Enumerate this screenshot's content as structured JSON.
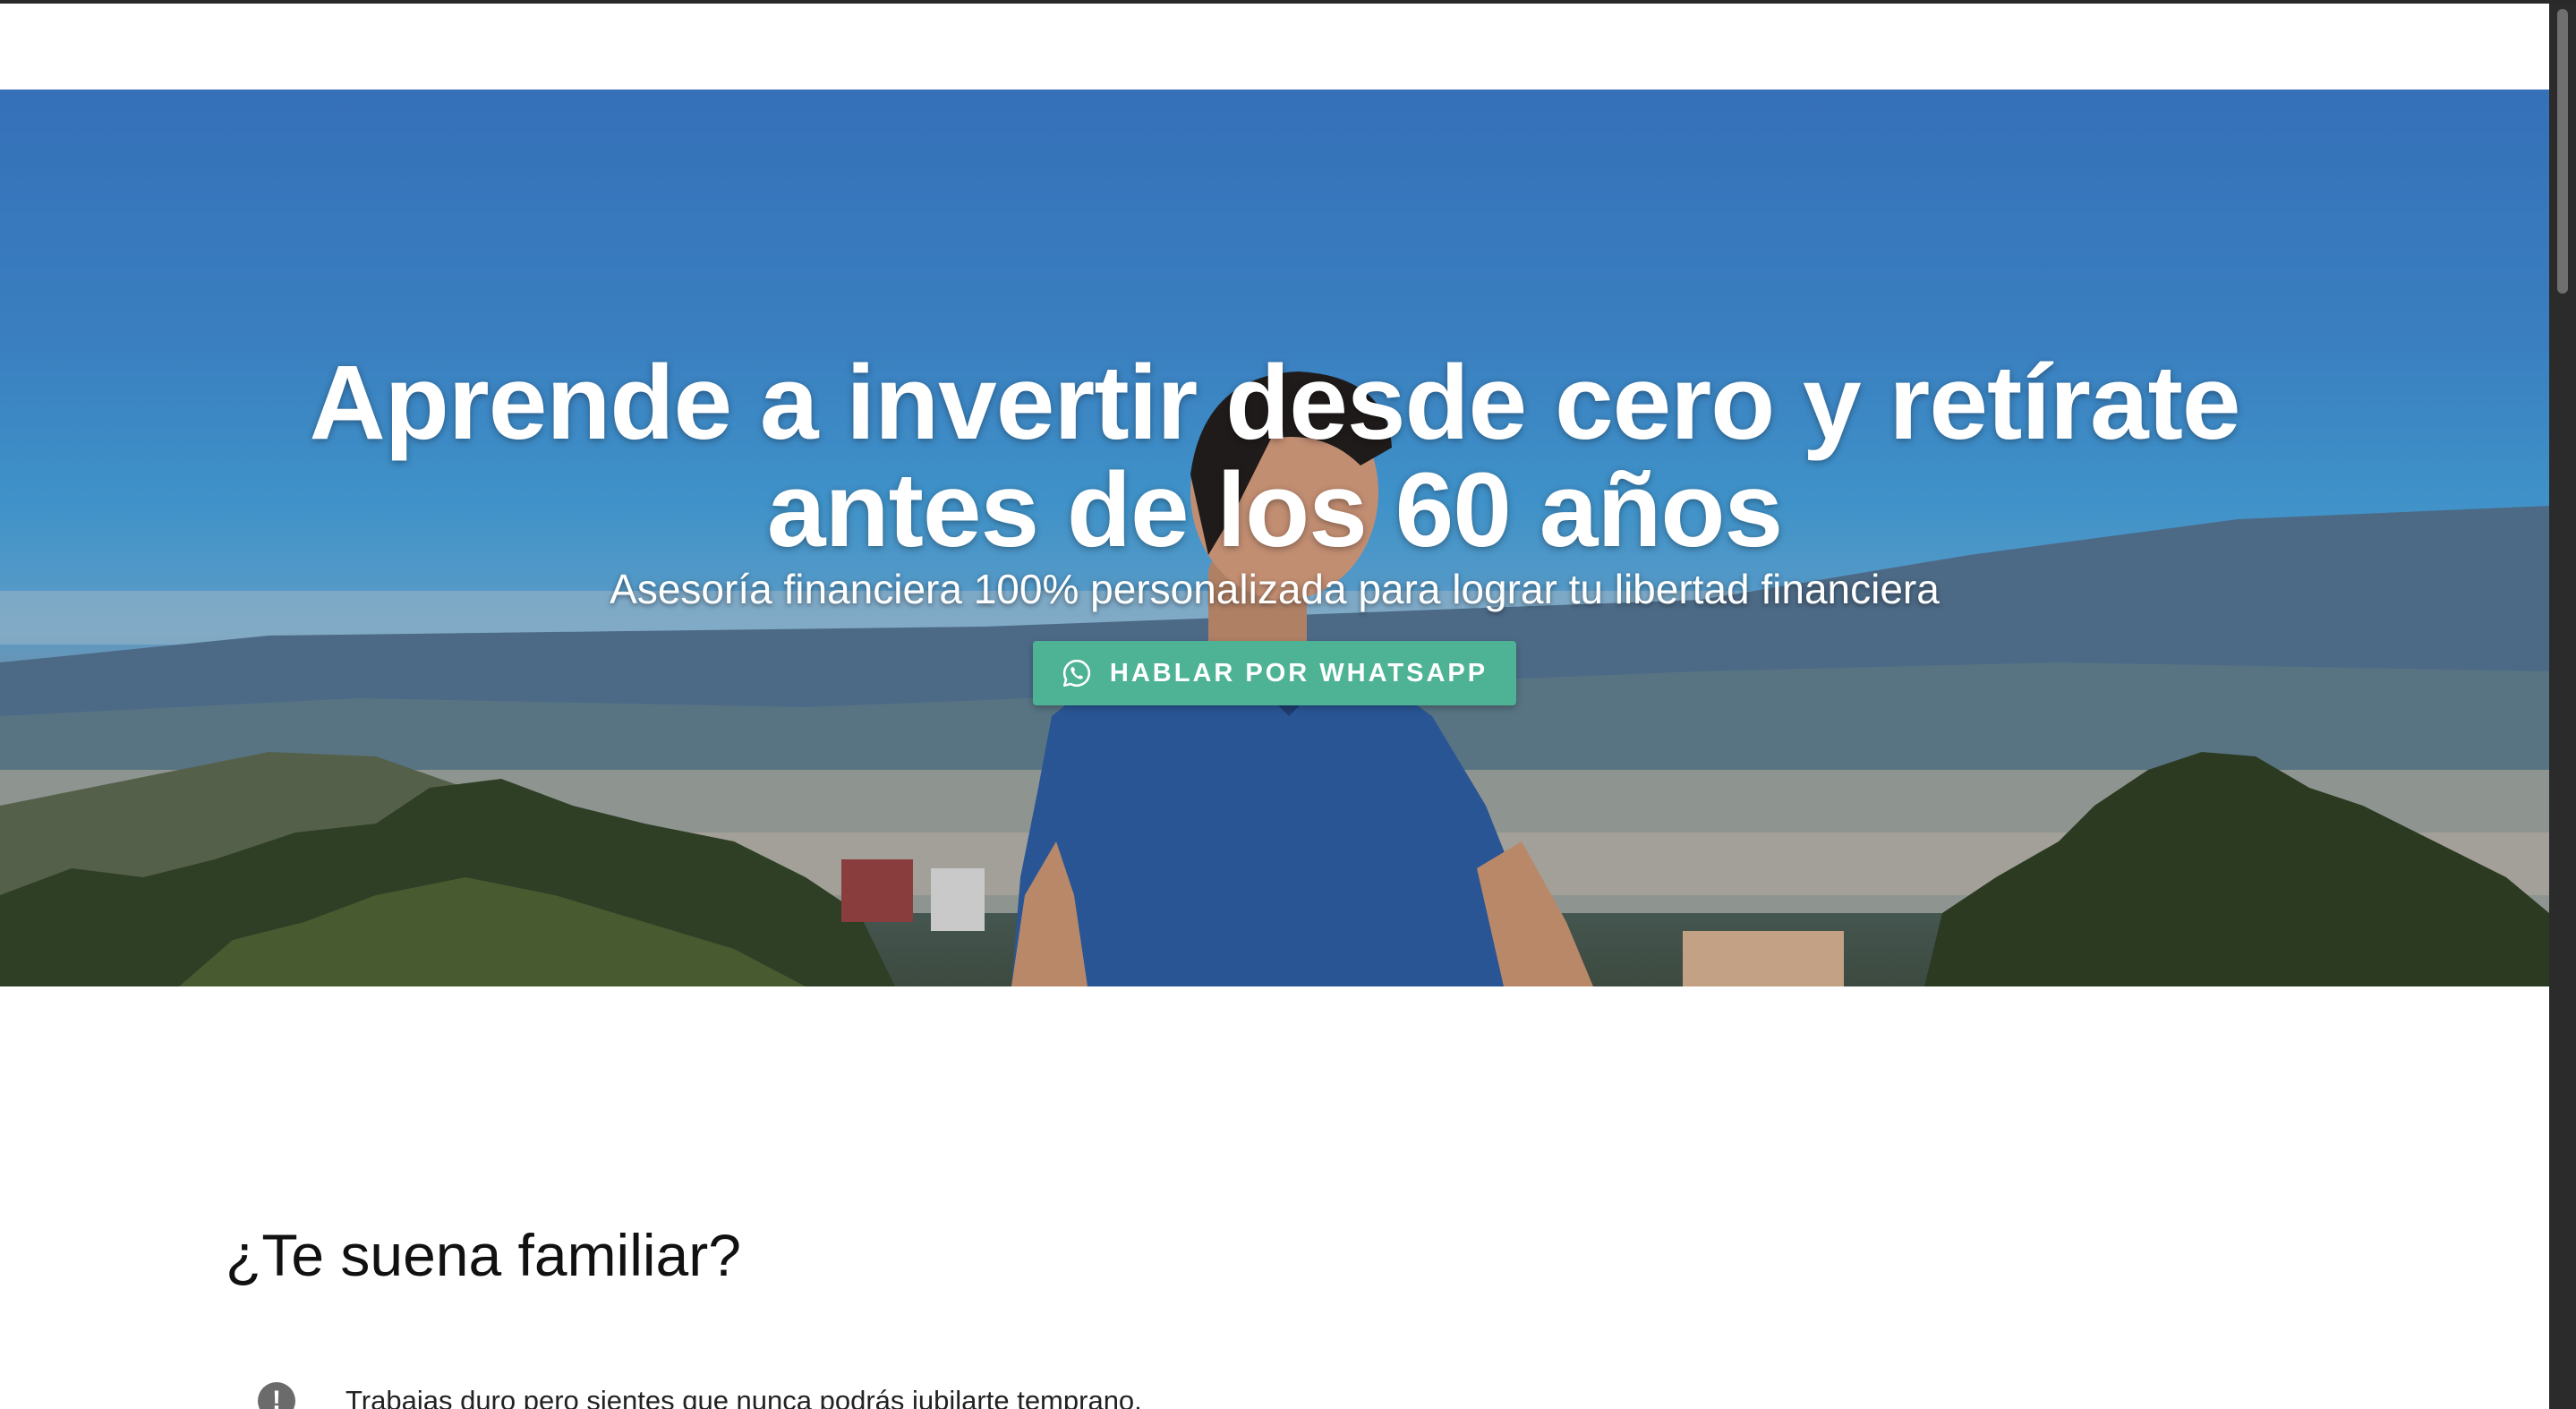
{
  "hero": {
    "title": "Aprende a invertir desde cero y retírate antes de los 60 años",
    "subtitle": "Asesoría financiera 100% personalizada para lograr tu libertad financiera",
    "cta_label": "HABLAR POR WHATSAPP",
    "cta_icon": "whatsapp-icon",
    "cta_color": "#4db394"
  },
  "familiar": {
    "heading": "¿Te suena familiar?",
    "items": [
      {
        "icon": "alert-circle-icon",
        "text": "Trabajas duro pero sientes que nunca podrás jubilarte temprano."
      }
    ]
  }
}
